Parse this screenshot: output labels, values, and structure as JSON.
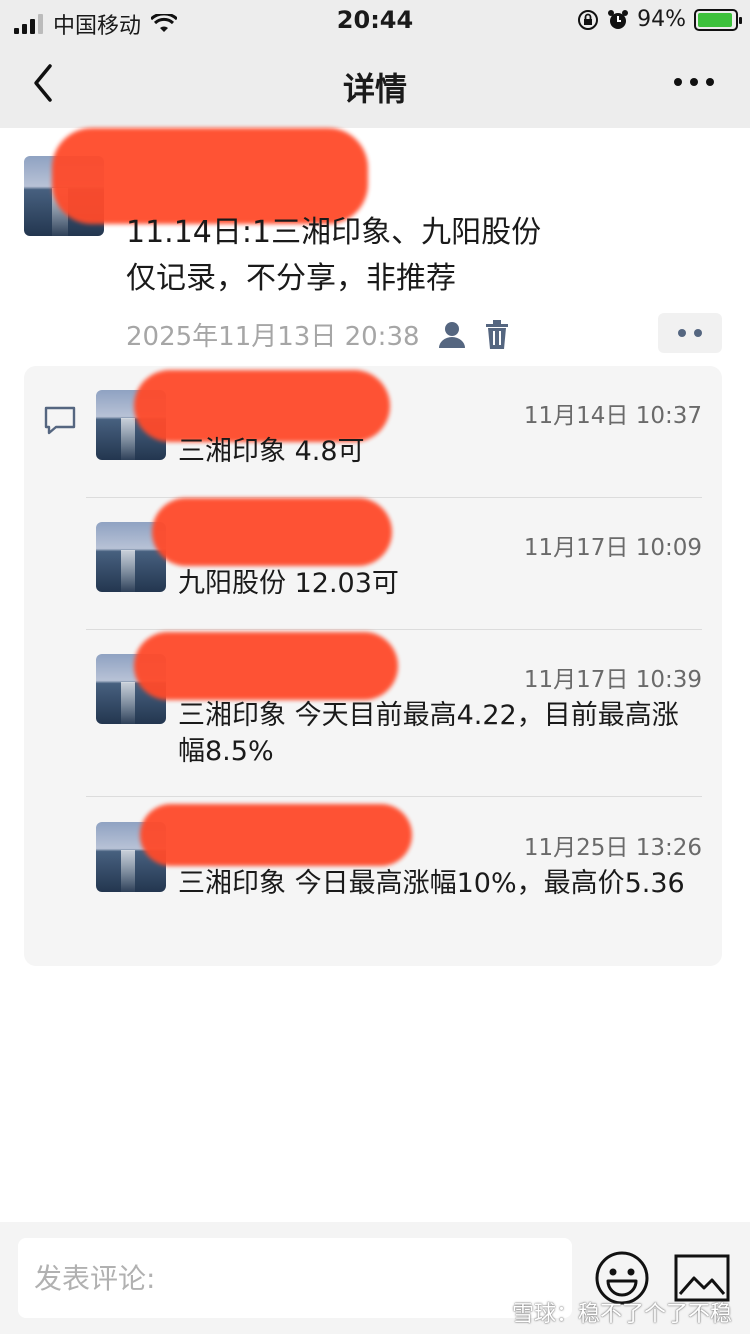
{
  "status_bar": {
    "carrier": "中国移动",
    "time": "20:44",
    "battery": "94%",
    "battery_level": 0.94
  },
  "nav": {
    "title": "详情"
  },
  "post": {
    "lines": [
      "11.14日:1三湘印象、九阳股份",
      "仅记录，不分享，非推荐"
    ],
    "timestamp": "2025年11月13日 20:38"
  },
  "comments": [
    {
      "time": "11月14日 10:37",
      "text": "三湘印象 4.8可"
    },
    {
      "time": "11月17日 10:09",
      "text": "九阳股份 12.03可"
    },
    {
      "time": "11月17日 10:39",
      "text": "三湘印象 今天目前最高4.22，目前最高涨幅8.5%"
    },
    {
      "time": "11月25日 13:26",
      "text": "三湘印象 今日最高涨幅10%，最高价5.36"
    }
  ],
  "input": {
    "placeholder": "发表评论:"
  },
  "watermark": "雪球：稳不了个了不稳",
  "colors": {
    "redaction": "#ff4a2a",
    "accent_icon": "#556680",
    "battery_fill": "#3cc13b"
  }
}
